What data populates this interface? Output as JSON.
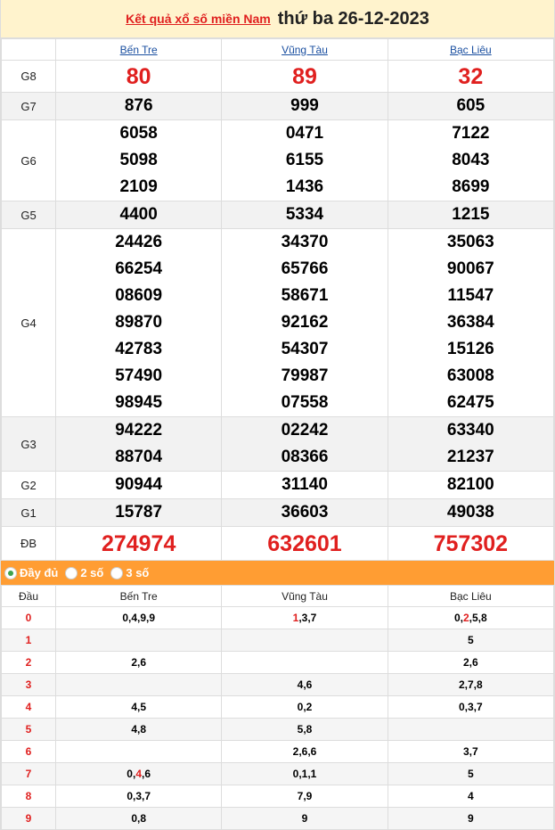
{
  "header": {
    "link": "Kết quả xổ số miền Nam",
    "date": "thứ ba 26-12-2023"
  },
  "provinces": [
    "Bến Tre",
    "Vũng Tàu",
    "Bạc Liêu"
  ],
  "prizes": [
    {
      "label": "G8",
      "values": [
        [
          "80"
        ],
        [
          "89"
        ],
        [
          "32"
        ]
      ]
    },
    {
      "label": "G7",
      "values": [
        [
          "876"
        ],
        [
          "999"
        ],
        [
          "605"
        ]
      ]
    },
    {
      "label": "G6",
      "values": [
        [
          "6058",
          "5098",
          "2109"
        ],
        [
          "0471",
          "6155",
          "1436"
        ],
        [
          "7122",
          "8043",
          "8699"
        ]
      ]
    },
    {
      "label": "G5",
      "values": [
        [
          "4400"
        ],
        [
          "5334"
        ],
        [
          "1215"
        ]
      ]
    },
    {
      "label": "G4",
      "values": [
        [
          "24426",
          "66254",
          "08609",
          "89870",
          "42783",
          "57490",
          "98945"
        ],
        [
          "34370",
          "65766",
          "58671",
          "92162",
          "54307",
          "79987",
          "07558"
        ],
        [
          "35063",
          "90067",
          "11547",
          "36384",
          "15126",
          "63008",
          "62475"
        ]
      ]
    },
    {
      "label": "G3",
      "values": [
        [
          "94222",
          "88704"
        ],
        [
          "02242",
          "08366"
        ],
        [
          "63340",
          "21237"
        ]
      ]
    },
    {
      "label": "G2",
      "values": [
        [
          "90944"
        ],
        [
          "31140"
        ],
        [
          "82100"
        ]
      ]
    },
    {
      "label": "G1",
      "values": [
        [
          "15787"
        ],
        [
          "36603"
        ],
        [
          "49038"
        ]
      ]
    },
    {
      "label": "ĐB",
      "values": [
        [
          "274974"
        ],
        [
          "632601"
        ],
        [
          "757302"
        ]
      ]
    }
  ],
  "options": [
    "Đầy đủ",
    "2 số",
    "3 số"
  ],
  "loto": {
    "head_label": "Đầu",
    "rows": [
      {
        "head": "0",
        "cells": [
          [
            [
              "0,4,9,9",
              false
            ]
          ],
          [
            [
              "1",
              true
            ],
            [
              ",3,7",
              false
            ]
          ],
          [
            [
              "0,",
              false
            ],
            [
              "2",
              true
            ],
            [
              ",5,8",
              false
            ]
          ]
        ]
      },
      {
        "head": "1",
        "cells": [
          [],
          [],
          [
            [
              "5",
              false
            ]
          ]
        ]
      },
      {
        "head": "2",
        "cells": [
          [
            [
              "2,6",
              false
            ]
          ],
          [],
          [
            [
              "2,6",
              false
            ]
          ]
        ]
      },
      {
        "head": "3",
        "cells": [
          [],
          [
            [
              "4,6",
              false
            ]
          ],
          [
            [
              "2,7,8",
              false
            ]
          ]
        ]
      },
      {
        "head": "4",
        "cells": [
          [
            [
              "4,5",
              false
            ]
          ],
          [
            [
              "0,2",
              false
            ]
          ],
          [
            [
              "0,3,7",
              false
            ]
          ]
        ]
      },
      {
        "head": "5",
        "cells": [
          [
            [
              "4,8",
              false
            ]
          ],
          [
            [
              "5,8",
              false
            ]
          ],
          []
        ]
      },
      {
        "head": "6",
        "cells": [
          [],
          [
            [
              "2,6,6",
              false
            ]
          ],
          [
            [
              "3,7",
              false
            ]
          ]
        ]
      },
      {
        "head": "7",
        "cells": [
          [
            [
              "0,",
              false
            ],
            [
              "4",
              true
            ],
            [
              ",6",
              false
            ]
          ],
          [
            [
              "0,1,1",
              false
            ]
          ],
          [
            [
              "5",
              false
            ]
          ]
        ]
      },
      {
        "head": "8",
        "cells": [
          [
            [
              "0,3,7",
              false
            ]
          ],
          [
            [
              "7,9",
              false
            ]
          ],
          [
            [
              "4",
              false
            ]
          ]
        ]
      },
      {
        "head": "9",
        "cells": [
          [
            [
              "0,8",
              false
            ]
          ],
          [
            [
              "9",
              false
            ]
          ],
          [
            [
              "9",
              false
            ]
          ]
        ]
      }
    ]
  },
  "colors": {
    "highlight": "#e0201f",
    "bar": "#ff9d33",
    "title_bg": "#fff3cd",
    "link": "#1a4fa0"
  }
}
